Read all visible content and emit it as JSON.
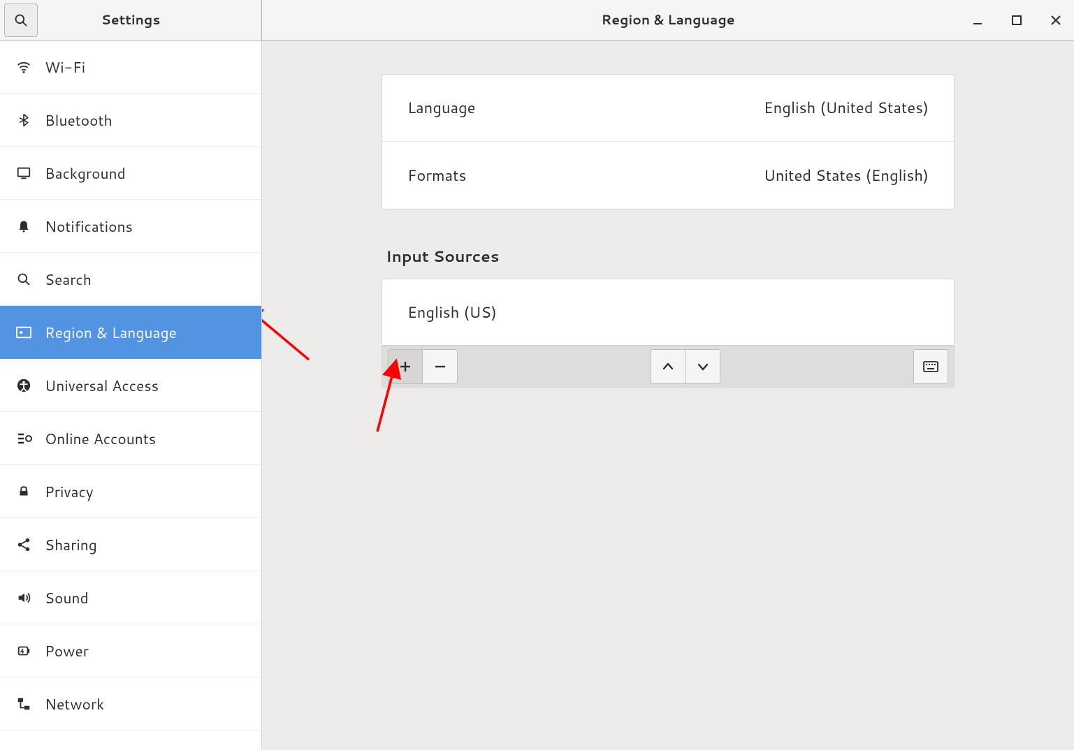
{
  "titlebar": {
    "sidebar_title": "Settings",
    "page_title": "Region & Language"
  },
  "sidebar": {
    "items": [
      {
        "icon": "wifi-icon",
        "label": "Wi-Fi",
        "selected": false
      },
      {
        "icon": "bluetooth-icon",
        "label": "Bluetooth",
        "selected": false
      },
      {
        "icon": "background-icon",
        "label": "Background",
        "selected": false
      },
      {
        "icon": "notifications-icon",
        "label": "Notifications",
        "selected": false
      },
      {
        "icon": "search-icon",
        "label": "Search",
        "selected": false
      },
      {
        "icon": "region-language-icon",
        "label": "Region & Language",
        "selected": true
      },
      {
        "icon": "universal-access-icon",
        "label": "Universal Access",
        "selected": false
      },
      {
        "icon": "online-accounts-icon",
        "label": "Online Accounts",
        "selected": false
      },
      {
        "icon": "privacy-icon",
        "label": "Privacy",
        "selected": false
      },
      {
        "icon": "sharing-icon",
        "label": "Sharing",
        "selected": false
      },
      {
        "icon": "sound-icon",
        "label": "Sound",
        "selected": false
      },
      {
        "icon": "power-icon",
        "label": "Power",
        "selected": false
      },
      {
        "icon": "network-icon",
        "label": "Network",
        "selected": false
      }
    ]
  },
  "main": {
    "language_row": {
      "label": "Language",
      "value": "English (United States)"
    },
    "formats_row": {
      "label": "Formats",
      "value": "United States (English)"
    },
    "input_sources_title": "Input Sources",
    "input_sources": [
      {
        "label": "English (US)"
      }
    ],
    "toolbar": {
      "add_label": "+",
      "remove_label": "−",
      "up_label": "▲",
      "down_label": "▼"
    }
  },
  "annotations": {
    "arrow_to_sidebar_item": true,
    "arrow_to_add_button": true
  }
}
